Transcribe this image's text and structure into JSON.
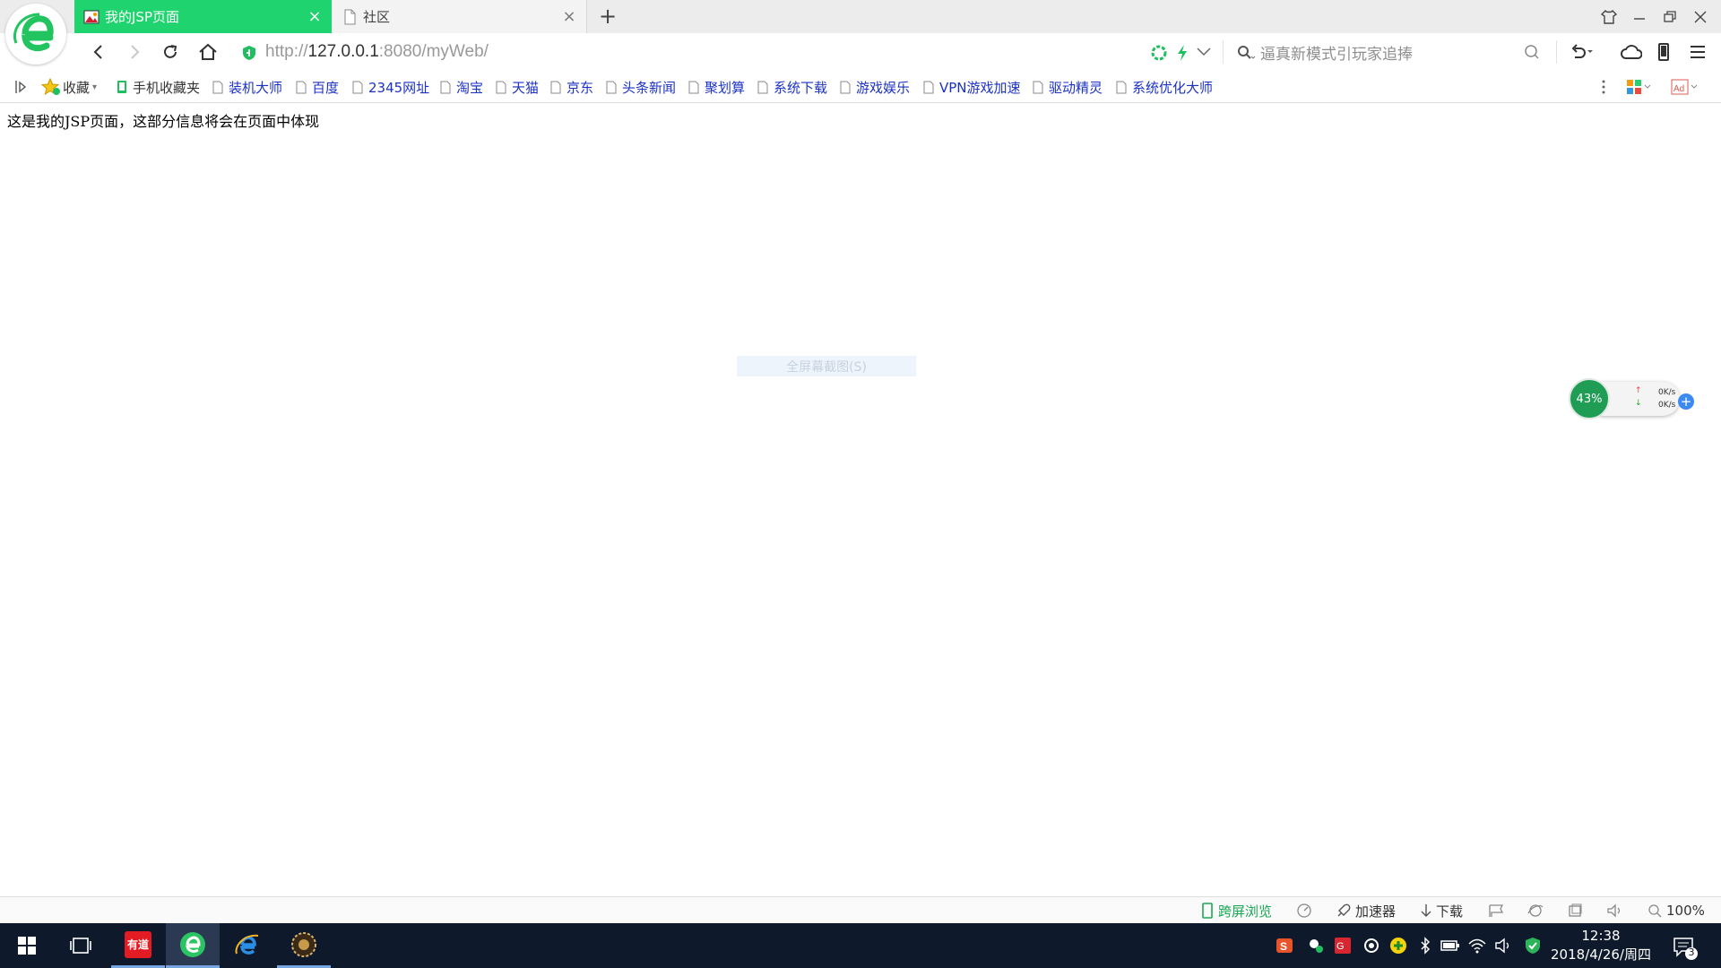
{
  "browser": {
    "tabs": [
      {
        "title": "我的JSP页面",
        "active": true
      },
      {
        "title": "社区",
        "active": false
      }
    ],
    "address": {
      "scheme": "http://",
      "host": "127.0.0.1",
      "rest": ":8080/myWeb/"
    },
    "search": {
      "placeholder": "逼真新模式引玩家追捧"
    },
    "bookmarks": {
      "collect_label": "收藏",
      "mobile_label": "手机收藏夹",
      "items": [
        "装机大师",
        "百度",
        "2345网址",
        "淘宝",
        "天猫",
        "京东",
        "头条新闻",
        "聚划算",
        "系统下载",
        "游戏娱乐",
        "VPN游戏加速",
        "驱动精灵",
        "系统优化大师"
      ]
    },
    "status": {
      "cross_screen": "跨屏浏览",
      "accelerator": "加速器",
      "download": "下载",
      "zoom": "100%"
    },
    "colors": {
      "accent": "#1fd36e",
      "link": "#1c32c4"
    }
  },
  "page": {
    "text": "这是我的JSP页面，这部分信息将会在页面中体现",
    "capture_hint": "全屏幕截图(S)"
  },
  "speed_widget": {
    "percent": "43%",
    "up": "0K/s",
    "down": "0K/s"
  },
  "taskbar": {
    "apps": [
      "windows-start",
      "task-view",
      "youdao-dict",
      "2345-browser",
      "internet-explorer",
      "game-app"
    ],
    "youdao_label": "有道",
    "time": "12:38",
    "date": "2018/4/26/周四",
    "notifications": "3"
  }
}
